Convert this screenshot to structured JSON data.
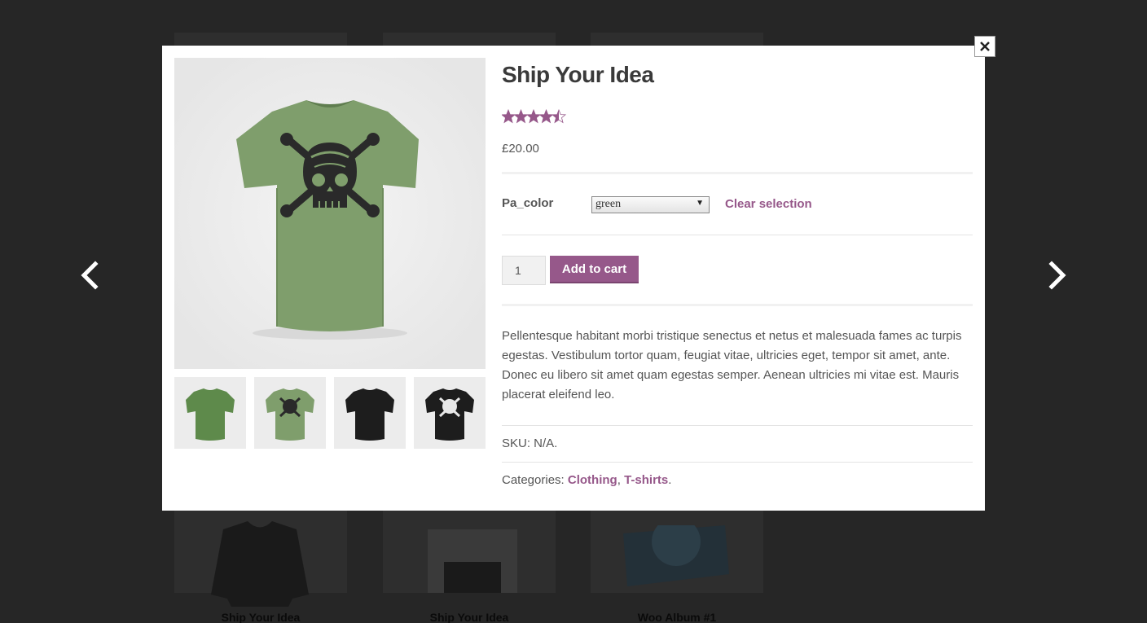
{
  "background": {
    "products": [
      {
        "title": "Ship Your Idea"
      },
      {
        "title": "Ship Your Idea"
      },
      {
        "title": "Woo Album #1"
      }
    ]
  },
  "product": {
    "title": "Ship Your Idea",
    "rating": 4.5,
    "rating_max": 5,
    "price": "£20.00",
    "variation_label": "Pa_color",
    "variation_selected": "green",
    "clear_label": "Clear selection",
    "quantity": "1",
    "add_to_cart_label": "Add to cart",
    "description": "Pellentesque habitant morbi tristique senectus et netus et malesuada fames ac turpis egestas. Vestibulum tortor quam, feugiat vitae, ultricies eget, tempor sit amet, ante. Donec eu libero sit amet quam egestas semper. Aenean ultricies mi vitae est. Mauris placerat eleifend leo.",
    "sku": "SKU: N/A.",
    "categories_label": "Categories:",
    "categories": [
      "Clothing",
      "T-shirts"
    ],
    "categories_sep": ",",
    "categories_end": "."
  },
  "colors": {
    "accent": "#96588a",
    "shirt_green": "#7f9e6c",
    "shirt_black": "#1d1d1d"
  },
  "icons": {
    "prev": "chevron-left-icon",
    "next": "chevron-right-icon",
    "close": "close-icon"
  }
}
